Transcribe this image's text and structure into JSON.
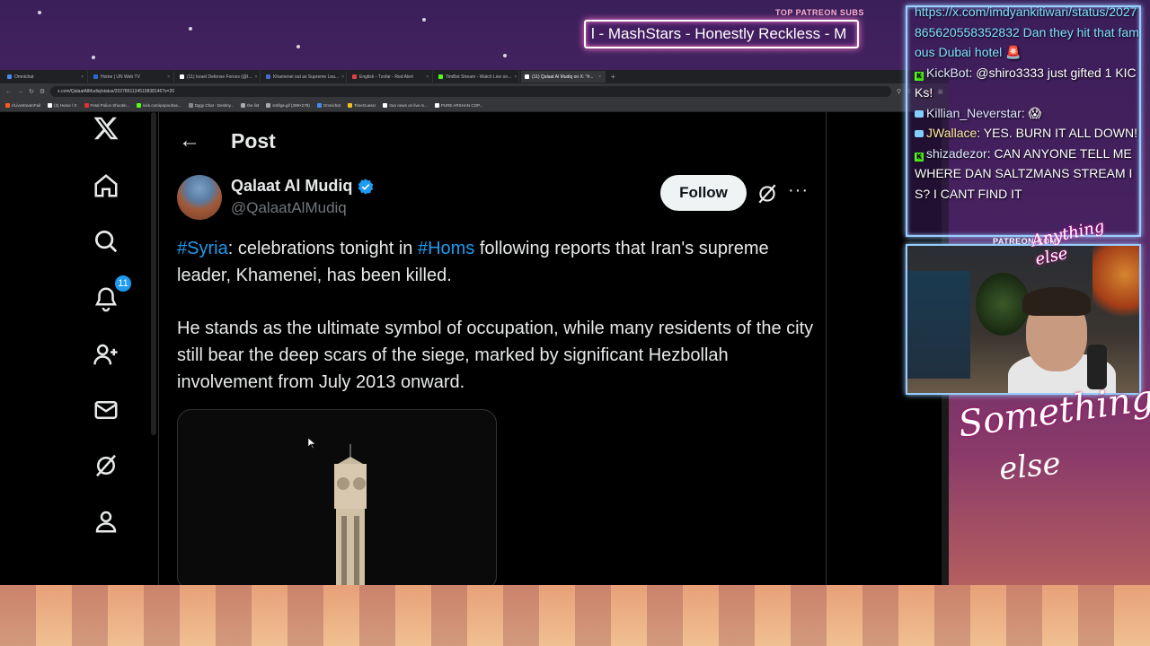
{
  "overlay": {
    "patreon_label": "TOP PATREON SUBS",
    "patreon_ticker": "l - MashStars - Honestly Reckless - M",
    "patreon_url": "PATREON.COM/",
    "signature_line1": "Something",
    "signature_line2": "else",
    "cam_logo": "Anything else"
  },
  "browser": {
    "tabs": [
      {
        "label": "Omnichat",
        "color": "#4a8af0",
        "active": false
      },
      {
        "label": "Home | UN Web TV",
        "color": "#2a6ad0",
        "active": false
      },
      {
        "label": "(11) Israel Defense Forces (@I...",
        "color": "#ffffff",
        "active": false
      },
      {
        "label": "Khamenei out as Supreme Lea...",
        "color": "#4a6ad0",
        "active": false
      },
      {
        "label": "English - Tzofar - Red Alert",
        "color": "#e04040",
        "active": false
      },
      {
        "label": "TimBot Stream - Watch Live on...",
        "color": "#53fc18",
        "active": false
      },
      {
        "label": "(11) Qalaat Al Mudiq on X: \"#...",
        "color": "#ffffff",
        "active": true
      }
    ],
    "new_tab": "+",
    "url": "x.com/QalaatAlMudiq/status/2027861134510838146?s=20",
    "bookmarks": [
      {
        "label": "r/LivestreamFail",
        "color": "#ff5a1a"
      },
      {
        "label": "(3) Home / X",
        "color": "#ffffff"
      },
      {
        "label": "Fetal Police Shootin...",
        "color": "#e03030"
      },
      {
        "label": "kick.com/popout/as...",
        "color": "#53fc18"
      },
      {
        "label": "Dggy Chat - Destiny...",
        "color": "#888888"
      },
      {
        "label": "the list",
        "color": "#aaaaaa"
      },
      {
        "label": "smflga-gif (299×278)",
        "color": "#aaaaaa"
      },
      {
        "label": "Omnichat",
        "color": "#4a8af0"
      },
      {
        "label": "TimeGuessr",
        "color": "#f0c020"
      },
      {
        "label": "Iran news on live m...",
        "color": "#ffffff"
      },
      {
        "label": "PURE ARSHAN COP...",
        "color": "#ffffff"
      }
    ]
  },
  "x": {
    "nav": {
      "notifications_badge": "11"
    },
    "post_header": "Post",
    "author_name": "Qalaat Al Mudiq",
    "author_handle": "@QalaatAlMudiq",
    "follow_label": "Follow",
    "more_label": "···",
    "tweet": {
      "p1_tag1": "#Syria",
      "p1_mid": ": celebrations tonight in ",
      "p1_tag2": "#Homs",
      "p1_end": " following reports that Iran's supreme leader, Khamenei, has been killed.",
      "p2": "He stands as the ultimate symbol of occupation, while many residents of the city still bear the deep scars of the siege, marked by significant Hezbollah involvement from July 2013 onward."
    }
  },
  "chat": {
    "messages": [
      {
        "platform": "none",
        "user": "",
        "user_class": "link",
        "text": "https://x.com/imdyankitiwari/status/2027865620558352832 Dan they hit that famous Dubai hotel 🚨"
      },
      {
        "platform": "kick",
        "user": "KickBot",
        "user_class": "uname-gray",
        "text": ": @shiro3333 just gifted 1 KICKs!"
      },
      {
        "platform": "twitch",
        "user": "Killian_Neverstar",
        "user_class": "uname-gray",
        "text": ": 😱"
      },
      {
        "platform": "twitch",
        "user": "JWallace",
        "user_class": "uname-yel",
        "text": ": YES. BURN IT ALL DOWN!"
      },
      {
        "platform": "kick",
        "user": "shizadezor",
        "user_class": "uname-gray",
        "text": ": CAN ANYONE TELL ME WHERE DAN SALTZMANS STREAM IS? I CANT FIND IT"
      }
    ]
  }
}
